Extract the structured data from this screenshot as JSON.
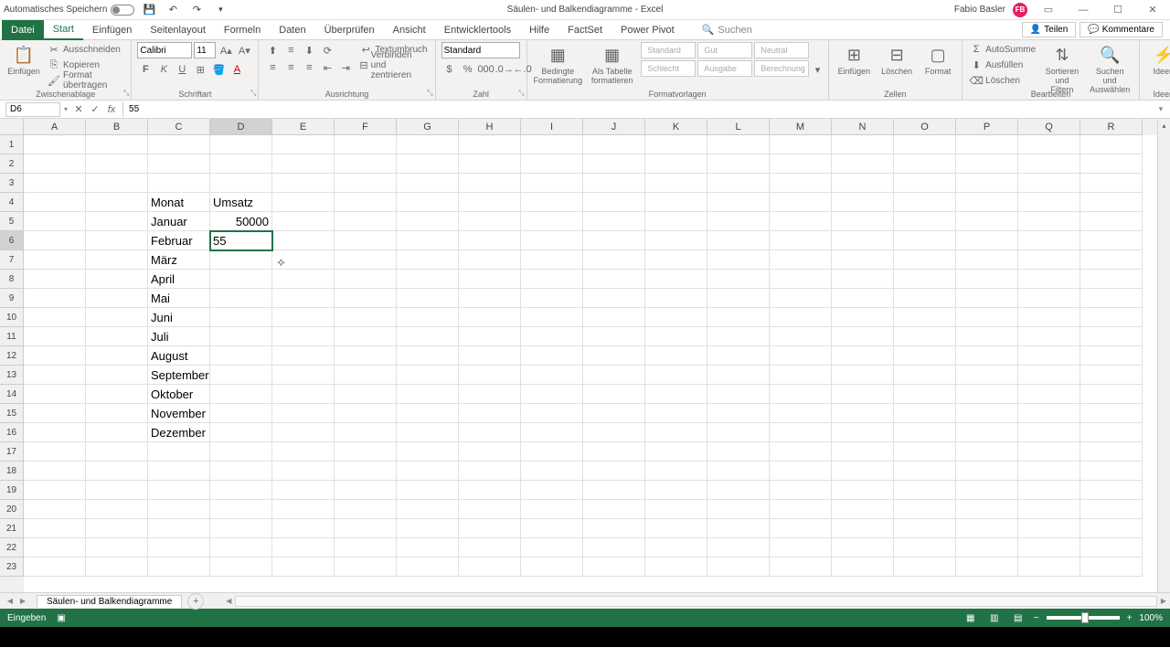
{
  "titlebar": {
    "autosave_label": "Automatisches Speichern",
    "doc_title": "Säulen- und Balkendiagramme - Excel",
    "user_name": "Fabio Basler",
    "user_initials": "FB"
  },
  "tabs": {
    "file": "Datei",
    "home": "Start",
    "insert": "Einfügen",
    "pagelayout": "Seitenlayout",
    "formulas": "Formeln",
    "data": "Daten",
    "review": "Überprüfen",
    "view": "Ansicht",
    "developer": "Entwicklertools",
    "help": "Hilfe",
    "factset": "FactSet",
    "powerpivot": "Power Pivot",
    "search": "Suchen",
    "share": "Teilen",
    "comments": "Kommentare"
  },
  "ribbon": {
    "clipboard": {
      "paste": "Einfügen",
      "cut": "Ausschneiden",
      "copy": "Kopieren",
      "format_painter": "Format übertragen",
      "group": "Zwischenablage"
    },
    "font": {
      "name": "Calibri",
      "size": "11",
      "group": "Schriftart"
    },
    "alignment": {
      "wrap": "Textumbruch",
      "merge": "Verbinden und zentrieren",
      "group": "Ausrichtung"
    },
    "number": {
      "format": "Standard",
      "group": "Zahl"
    },
    "styles": {
      "conditional": "Bedingte Formatierung",
      "table": "Als Tabelle formatieren",
      "s1": "Standard",
      "s2": "Gut",
      "s3": "Neutral",
      "s4": "Schlecht",
      "s5": "Ausgabe",
      "s6": "Berechnung",
      "group": "Formatvorlagen"
    },
    "cells": {
      "insert": "Einfügen",
      "delete": "Löschen",
      "format": "Format",
      "group": "Zellen"
    },
    "editing": {
      "autosum": "AutoSumme",
      "fill": "Ausfüllen",
      "clear": "Löschen",
      "sort": "Sortieren und Filtern",
      "find": "Suchen und Auswählen",
      "group": "Bearbeiten"
    },
    "ideas": {
      "label": "Ideen",
      "group": "Ideen"
    }
  },
  "namebox": "D6",
  "formula": "55",
  "columns": [
    "A",
    "B",
    "C",
    "D",
    "E",
    "F",
    "G",
    "H",
    "I",
    "J",
    "K",
    "L",
    "M",
    "N",
    "O",
    "P",
    "Q",
    "R"
  ],
  "active_col": "D",
  "active_row": 6,
  "rows": 23,
  "data_cells": {
    "C4": {
      "v": "Monat",
      "t": "text"
    },
    "D4": {
      "v": "Umsatz",
      "t": "text"
    },
    "C5": {
      "v": "Januar",
      "t": "text"
    },
    "D5": {
      "v": "50000",
      "t": "num"
    },
    "C6": {
      "v": "Februar",
      "t": "text"
    },
    "D6": {
      "v": "55",
      "t": "text",
      "editing": true
    },
    "C7": {
      "v": "März",
      "t": "text"
    },
    "C8": {
      "v": "April",
      "t": "text"
    },
    "C9": {
      "v": "Mai",
      "t": "text"
    },
    "C10": {
      "v": "Juni",
      "t": "text"
    },
    "C11": {
      "v": "Juli",
      "t": "text"
    },
    "C12": {
      "v": "August",
      "t": "text"
    },
    "C13": {
      "v": "September",
      "t": "text"
    },
    "C14": {
      "v": "Oktober",
      "t": "text"
    },
    "C15": {
      "v": "November",
      "t": "text"
    },
    "C16": {
      "v": "Dezember",
      "t": "text"
    }
  },
  "cursor_pos": {
    "col": "E",
    "row": 7
  },
  "sheet_name": "Säulen- und Balkendiagramme",
  "status": "Eingeben",
  "zoom": "100%"
}
